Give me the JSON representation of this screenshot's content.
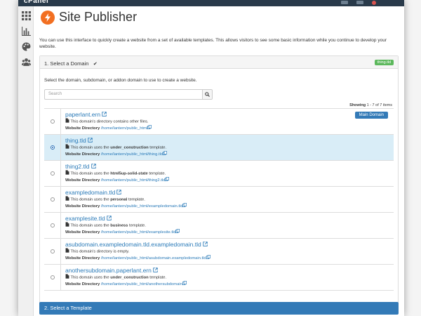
{
  "topbar": {
    "logo": "cPanel"
  },
  "page": {
    "title": "Site Publisher"
  },
  "intro": "You can use this interface to quickly create a website from a set of available templates. This allows visitors to see some basic information while you continue to develop your website.",
  "step1": {
    "title": "1. Select a Domain",
    "selected_domain": "thing.tld",
    "instructions": "Select the domain, subdomain, or addon domain to use to create a website.",
    "search_placeholder": "Search",
    "showing_label": "Showing",
    "showing_range": "1 - 7 of 7 items",
    "dir_label": "Website Directory",
    "main_badge": "Main Domain",
    "rows": [
      {
        "domain": "paperlant.ern",
        "desc_prefix": "This domain's directory contains other files.",
        "template": "",
        "desc_suffix": "",
        "dir": "/home/lantern/public_html"
      },
      {
        "domain": "thing.tld",
        "desc_prefix": "This domain uses the ",
        "template": "under_construction",
        "desc_suffix": " template.",
        "dir": "/home/lantern/public_html/thing.tld"
      },
      {
        "domain": "thing2.tld",
        "desc_prefix": "This domain uses the ",
        "template": "html5up-solid-state",
        "desc_suffix": " template.",
        "dir": "/home/lantern/public_html/thing2.tld"
      },
      {
        "domain": "exampledomain.tld",
        "desc_prefix": "This domain uses the ",
        "template": "personal",
        "desc_suffix": " template.",
        "dir": "/home/lantern/public_html/exampledomain.tld"
      },
      {
        "domain": "examplesite.tld",
        "desc_prefix": "This domain uses the ",
        "template": "business",
        "desc_suffix": " template.",
        "dir": "/home/lantern/public_html/examplesite.tld"
      },
      {
        "domain": "asubdomain.exampledomain.tld.exampledomain.tld",
        "desc_prefix": "This domain's directory is empty.",
        "template": "",
        "desc_suffix": "",
        "dir": "/home/lantern/public_html/asubdomain.exampledomain.tld"
      },
      {
        "domain": "anothersubdomain.paperlant.ern",
        "desc_prefix": "This domain uses the ",
        "template": "under_construction",
        "desc_suffix": " template.",
        "dir": "/home/lantern/public_html/anothersubdomain"
      }
    ]
  },
  "step2": {
    "title": "2. Select a Template"
  },
  "colors": {
    "accent": "#337ab7",
    "link": "#2a7ab8",
    "brand": "#f26f21",
    "selected_row": "#d9edf7",
    "success": "#5cb85c",
    "topbar": "#293a4a"
  }
}
